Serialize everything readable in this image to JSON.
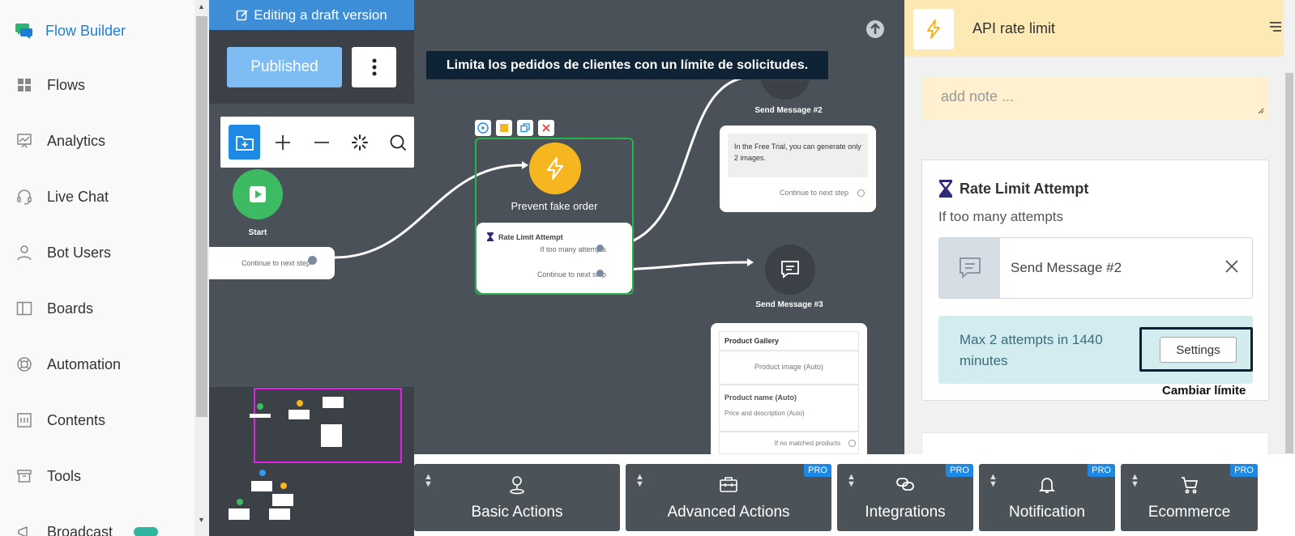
{
  "sidebar": {
    "brand": "Flow Builder",
    "items": [
      {
        "label": "Flows",
        "icon": "grid-icon"
      },
      {
        "label": "Analytics",
        "icon": "chart-icon"
      },
      {
        "label": "Live Chat",
        "icon": "headset-icon"
      },
      {
        "label": "Bot Users",
        "icon": "user-icon"
      },
      {
        "label": "Boards",
        "icon": "board-icon"
      },
      {
        "label": "Automation",
        "icon": "lifebuoy-icon"
      },
      {
        "label": "Contents",
        "icon": "contents-icon"
      },
      {
        "label": "Tools",
        "icon": "archive-icon"
      }
    ],
    "partial_item": "Broadcast"
  },
  "editor": {
    "draft_banner": "Editing a draft version",
    "published_label": "Published"
  },
  "canvas": {
    "tooltip": "Limita los pedidos de clientes con un límite de solicitudes.",
    "start_label": "Start",
    "start_card": "Continue to next step",
    "prevent_label": "Prevent fake order",
    "rate_title": "Rate Limit Attempt",
    "rate_row1": "If too many attempts",
    "rate_row2": "Continue to next step",
    "send2_label": "Send Message #2",
    "send2_text": "In the Free Trial, you can generate only 2 images.",
    "send2_cont": "Continue to next step",
    "send3_label": "Send Message #3",
    "gallery_title": "Product Gallery",
    "gallery_image": "Product image (Auto)",
    "gallery_name": "Product name (Auto)",
    "gallery_desc": "Price and description (Auto)",
    "gallery_nomatch": "If no matched products"
  },
  "categories": [
    {
      "label": "Basic Actions",
      "pro": "",
      "icon": "person-pin-icon"
    },
    {
      "label": "Advanced Actions",
      "pro": "PRO",
      "icon": "briefcase-icon"
    },
    {
      "label": "Integrations",
      "pro": "PRO",
      "icon": "link-icon"
    },
    {
      "label": "Notification",
      "pro": "PRO",
      "icon": "bell-icon"
    },
    {
      "label": "Ecommerce",
      "pro": "PRO",
      "icon": "cart-icon"
    }
  ],
  "panel": {
    "title": "API rate limit",
    "note_placeholder": "add note ...",
    "section_title": "Rate Limit Attempt",
    "section_sub": "If too many attempts",
    "linked_step": "Send Message #2",
    "limit_text": "Max 2 attempts in 1440 minutes",
    "settings_label": "Settings",
    "annotation": "Cambiar límite"
  },
  "colors": {
    "accent": "#1e88e5",
    "canvas": "#4a5158",
    "panel_header": "#fde9b3",
    "limit_bg": "#d2ecf0",
    "bolt": "#f6b61f",
    "start": "#3dbb63"
  }
}
